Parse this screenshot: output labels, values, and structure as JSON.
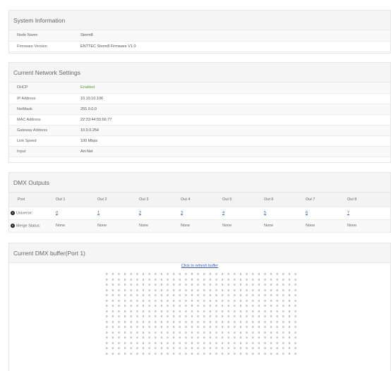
{
  "system": {
    "title": "System Information",
    "rows": [
      {
        "label": "Node Name",
        "value": "Storm8"
      },
      {
        "label": "Firmware Version",
        "value": "ENTTEC Storm8 Firmware V1.0"
      }
    ]
  },
  "network": {
    "title": "Current Network Settings",
    "rows": [
      {
        "label": "DHCP",
        "value": "Enabled"
      },
      {
        "label": "IP Address",
        "value": "10.10.10.106"
      },
      {
        "label": "NetMask",
        "value": "255.0.0.0"
      },
      {
        "label": "MAC Address",
        "value": "22:33:44:55:66:77"
      },
      {
        "label": "Gateway Address",
        "value": "10.0.0.254"
      },
      {
        "label": "Link Speed",
        "value": "100 Mbps"
      },
      {
        "label": "Input",
        "value": "Art-Net"
      }
    ],
    "accent_enabled_color": "#5a9e3a"
  },
  "dmx": {
    "title": "DMX Outputs",
    "port_label": "Port",
    "outputs": [
      "Out 1",
      "Out 2",
      "Out 3",
      "Out 4",
      "Out 5",
      "Out 6",
      "Out 7",
      "Out 8"
    ],
    "universe_label": "Universe:",
    "universes": [
      "0",
      "1",
      "2",
      "3",
      "4",
      "5",
      "6",
      "7"
    ],
    "merge_label": "Merge Status:",
    "merge_status": [
      "None",
      "None",
      "None",
      "None",
      "None",
      "None",
      "None",
      "None"
    ],
    "info_icon": "info-icon"
  },
  "buffer": {
    "title": "Current DMX buffer(Port 1)",
    "refresh_link": "Click to refresh buffer",
    "rows": 16,
    "cols": 32,
    "cell_value": "0"
  }
}
